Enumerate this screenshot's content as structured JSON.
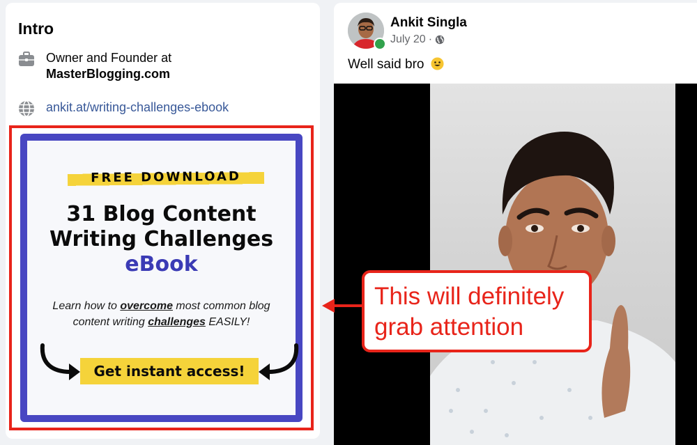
{
  "intro": {
    "title": "Intro",
    "work_line1": "Owner and Founder at",
    "work_line2": "MasterBlogging.com",
    "website": "ankit.at/writing-challenges-ebook",
    "icons": [
      "briefcase-icon",
      "globe-icon"
    ]
  },
  "ebook": {
    "tag": "FREE DOWNLOAD",
    "title_line1": "31 Blog Content",
    "title_line2": "Writing Challenges",
    "accent": "eBook",
    "desc_part1": "Learn how to ",
    "desc_bold1": "overcome",
    "desc_part2": " most common blog content writing ",
    "desc_bold2": "challenges",
    "desc_part3": " EASILY!",
    "cta": "Get instant access!",
    "colors": {
      "border": "#4847c2",
      "highlight": "#f5d33a",
      "accent": "#3b3bb5"
    }
  },
  "post": {
    "author": "Ankit Singla",
    "date": "July 20",
    "separator": "·",
    "privacy_icon": "globe-icon",
    "text": "Well said bro",
    "emoji": "smiling-face-emoji"
  },
  "annotation": {
    "callout_line1": "This will definitely",
    "callout_line2": "grab attention",
    "color": "#e8241a"
  }
}
